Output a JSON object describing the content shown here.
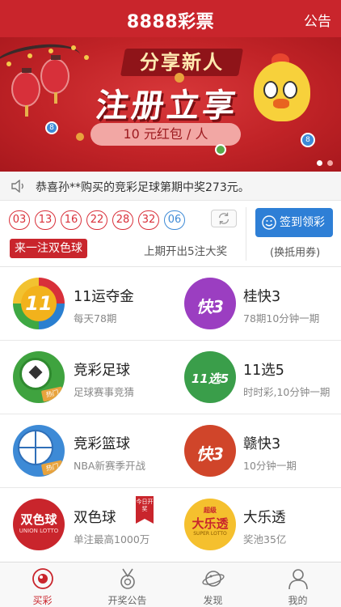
{
  "header": {
    "title": "8888彩票",
    "notice_label": "公告"
  },
  "banner": {
    "line1": "分享新人",
    "line2": "注册立享",
    "reward": "10 元红包 / 人",
    "ball_numbers": [
      "8",
      "8"
    ]
  },
  "ticker": {
    "text": "恭喜孙**购买的竞彩足球第期中奖273元。",
    "icon": "speaker-icon"
  },
  "lotto": {
    "red_balls": [
      "03",
      "13",
      "16",
      "22",
      "28",
      "32"
    ],
    "blue_ball": "06",
    "play_button": "来一注双色球",
    "last_draw_info": "上期开出5注大奖",
    "sign_button": "签到领彩豆",
    "sign_note": "(换抵用券)"
  },
  "games": [
    {
      "name": "11运夺金",
      "desc": "每天78期",
      "logo_text": "11"
    },
    {
      "name": "桂快3",
      "desc": "78期10分钟一期",
      "logo_text": "快3"
    },
    {
      "name": "竞彩足球",
      "desc": "足球赛事竞猜",
      "badge": "热门"
    },
    {
      "name": "11选5",
      "desc": "时时彩,10分钟一期",
      "logo_text": "11选5"
    },
    {
      "name": "竞彩篮球",
      "desc": "NBA新赛季开战",
      "badge": "热门"
    },
    {
      "name": "赣快3",
      "desc": "10分钟一期",
      "logo_text": "快3"
    },
    {
      "name": "双色球",
      "desc": "单注最高1000万",
      "logo_text": "双色球",
      "logo_sub": "UNION LOTTO",
      "tag": "今日开奖"
    },
    {
      "name": "大乐透",
      "desc": "奖池35亿",
      "logo_text": "大乐透",
      "logo_top": "超级",
      "logo_sub": "SUPER LOTTO"
    }
  ],
  "tabs": [
    {
      "label": "买彩",
      "active": true
    },
    {
      "label": "开奖公告",
      "active": false
    },
    {
      "label": "发现",
      "active": false
    },
    {
      "label": "我的",
      "active": false
    }
  ],
  "colors": {
    "brand_red": "#c9252c",
    "blue": "#2e7fd6",
    "ball_blue": "#3d8ad6"
  }
}
